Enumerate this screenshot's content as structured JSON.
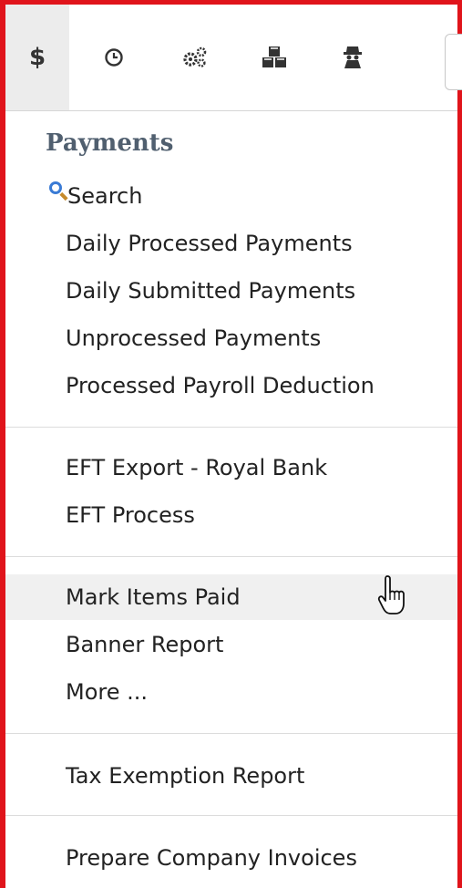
{
  "toolbar": {
    "tabs": [
      {
        "icon": "dollar-icon",
        "label": "$",
        "active": true
      },
      {
        "icon": "clock-icon"
      },
      {
        "icon": "gears-icon"
      },
      {
        "icon": "boxes-icon"
      },
      {
        "icon": "spy-icon"
      }
    ]
  },
  "menu": {
    "section_title": "Payments",
    "search_label": "Search",
    "group1": [
      "Daily Processed Payments",
      "Daily Submitted Payments",
      "Unprocessed Payments",
      "Processed Payroll Deduction"
    ],
    "group2": [
      "EFT Export - Royal Bank",
      "EFT Process"
    ],
    "group3": [
      "Mark Items Paid",
      "Banner Report",
      "More ..."
    ],
    "group4": [
      "Tax Exemption Report"
    ],
    "group5": [
      "Prepare Company Invoices"
    ]
  },
  "colors": {
    "frame_border": "#e0141b",
    "title": "#505f6f",
    "hover_bg": "#f0f0f0"
  }
}
